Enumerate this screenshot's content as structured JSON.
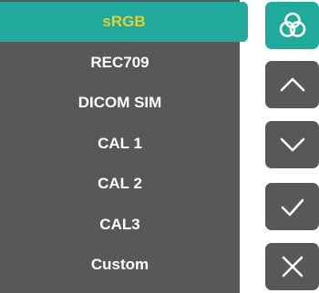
{
  "menu": {
    "items": [
      {
        "label": "sRGB",
        "selected": true
      },
      {
        "label": "REC709",
        "selected": false
      },
      {
        "label": "DICOM SIM",
        "selected": false
      },
      {
        "label": "CAL 1",
        "selected": false
      },
      {
        "label": "CAL 2",
        "selected": false
      },
      {
        "label": "CAL3",
        "selected": false
      },
      {
        "label": "Custom",
        "selected": false
      }
    ]
  },
  "buttons": [
    {
      "name": "color-mode-button",
      "icon": "color-circles-icon"
    },
    {
      "name": "up-button",
      "icon": "chevron-up-icon"
    },
    {
      "name": "down-button",
      "icon": "chevron-down-icon"
    },
    {
      "name": "confirm-button",
      "icon": "checkmark-icon"
    },
    {
      "name": "close-button",
      "icon": "close-icon"
    }
  ],
  "colors": {
    "accent": "#1faa9b",
    "panel": "#585858",
    "selected_text": "#e6cc38",
    "text": "#ffffff"
  }
}
